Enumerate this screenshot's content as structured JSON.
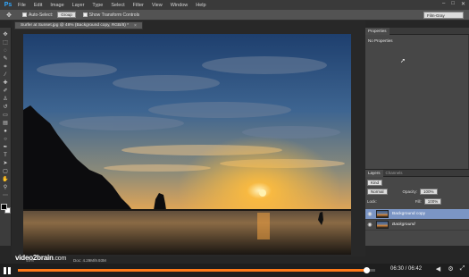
{
  "app": {
    "logo": "Ps",
    "menus": [
      "File",
      "Edit",
      "Image",
      "Layer",
      "Type",
      "Select",
      "Filter",
      "View",
      "Window",
      "Help"
    ],
    "window_controls": [
      "–",
      "□",
      "✕"
    ]
  },
  "options": {
    "auto_select_label": "Auto-Select:",
    "auto_select_value": "Group",
    "transform_label": "Show Transform Controls",
    "workspace": "Film-Gray"
  },
  "document": {
    "tab_title": "Surfer at Sunset.jpg @ 48% (Background copy, RGB/8) *",
    "close": "×",
    "zoom": "48%",
    "doc_info": "Doc: 4.29M/9.93M"
  },
  "properties": {
    "tab_label": "Properties",
    "message": "No Properties"
  },
  "layers": {
    "tabs": [
      "Layers",
      "Channels"
    ],
    "kind_label": "Kind",
    "blend_mode": "Normal",
    "opacity_label": "Opacity:",
    "opacity_value": "100%",
    "lock_label": "Lock:",
    "fill_label": "Fill:",
    "fill_value": "100%",
    "items": [
      {
        "name": "Background copy",
        "selected": true
      },
      {
        "name": "Background",
        "selected": false
      }
    ]
  },
  "player": {
    "time": "06:30 / 06:42",
    "progress": 0.975
  },
  "watermark": {
    "brand": "video2brain",
    "suffix": ".com"
  },
  "colors": {
    "accent": "#ff7a1a",
    "layer_selected": "#7b95c4"
  }
}
